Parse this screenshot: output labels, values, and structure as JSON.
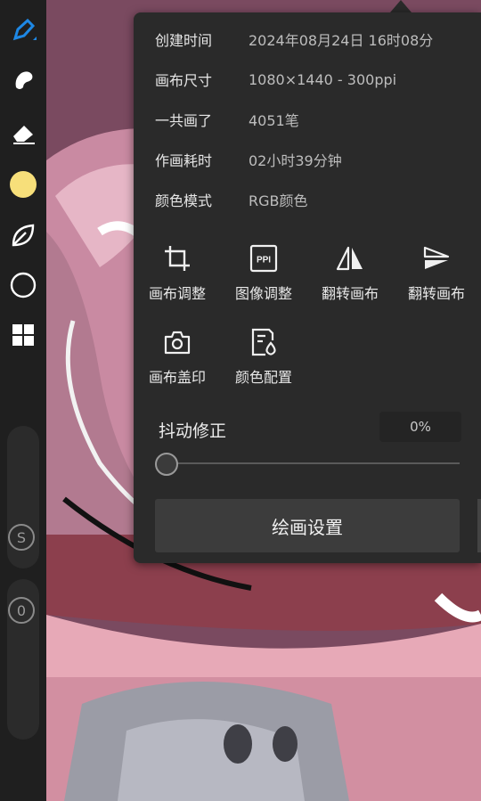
{
  "info": [
    {
      "label": "创建时间",
      "value": "2024年08月24日 16时08分"
    },
    {
      "label": "画布尺寸",
      "value": "1080×1440 - 300ppi"
    },
    {
      "label": "一共画了",
      "value": "4051笔"
    },
    {
      "label": "作画耗时",
      "value": "02小时39分钟"
    },
    {
      "label": "颜色模式",
      "value": "RGB颜色"
    }
  ],
  "actions": [
    {
      "label": "画布调整",
      "icon": "crop-icon"
    },
    {
      "label": "图像调整",
      "icon": "ppi-icon",
      "icon_text": "PPI"
    },
    {
      "label": "翻转画布",
      "icon": "flip-horizontal-icon"
    },
    {
      "label": "翻转画布",
      "icon": "flip-vertical-icon"
    },
    {
      "label": "画布盖印",
      "icon": "camera-icon"
    },
    {
      "label": "颜色配置",
      "icon": "color-profile-icon"
    }
  ],
  "stabilizer": {
    "label": "抖动修正",
    "value": "0%",
    "level": 0
  },
  "settings_button": "绘画设置",
  "toolbar": {
    "tools": [
      "brush-icon",
      "smudge-icon",
      "eraser-icon",
      "color-swatch",
      "leaf-icon",
      "circle-icon",
      "layers-grid-icon"
    ],
    "current_color": "#f7df7a",
    "size_knob": "S",
    "opacity_knob": "0"
  },
  "colors": {
    "panel": "#2a2a2a",
    "toolbar": "#1f1f1f",
    "accent": "#1e88e5"
  }
}
